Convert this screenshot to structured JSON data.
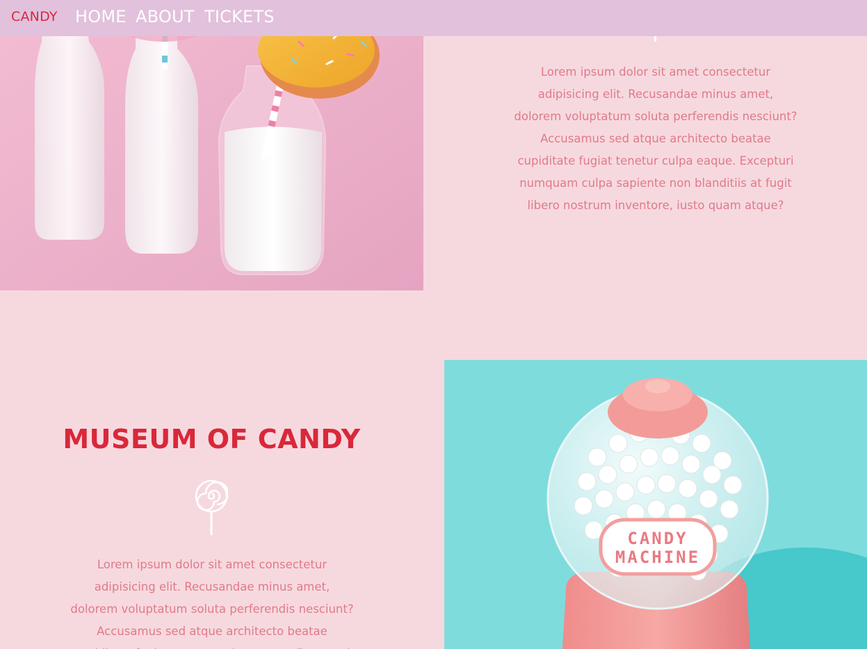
{
  "nav": {
    "brand": "CANDY",
    "links": [
      {
        "label": "HOME"
      },
      {
        "label": "ABOUT"
      },
      {
        "label": "TICKETS"
      }
    ]
  },
  "section1": {
    "paragraph": "Lorem ipsum dolor sit amet consectetur adipisicing elit. Recusandae minus amet, dolorem voluptatum soluta perferendis nesciunt? Accusamus sed atque architecto beatae cupiditate fugiat tenetur culpa eaque. Excepturi numquam culpa sapiente non blanditiis at fugit libero nostrum inventore, iusto quam atque?"
  },
  "section2": {
    "title": "MUSEUM OF CANDY",
    "paragraph": "Lorem ipsum dolor sit amet consectetur adipisicing elit. Recusandae minus amet, dolorem voluptatum soluta perferendis nesciunt? Accusamus sed atque architecto beatae cupiditate fugiat tenetur culpa eaque. Excepturi"
  },
  "gumball_label": {
    "line1": "CANDY",
    "line2": "MACHINE"
  },
  "colors": {
    "background": "#f6d9df",
    "navbar": "#e2c1dd",
    "accent_red": "#d9283a",
    "body_text": "#e07a8a"
  },
  "icons": {
    "lollipop": "lollipop-icon"
  }
}
